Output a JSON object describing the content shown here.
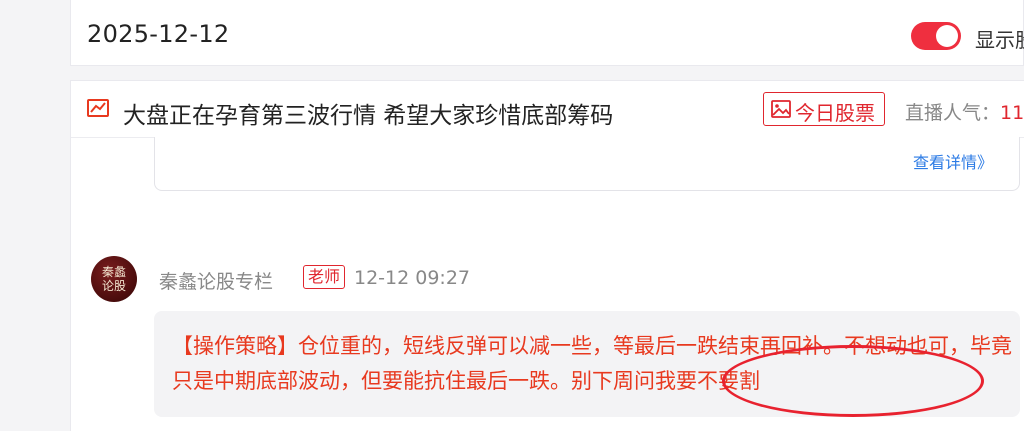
{
  "date_bar": {
    "date": "2025-12-12",
    "toggle_label": "显示股",
    "toggle_on": true
  },
  "live": {
    "title": "大盘正在孕育第三波行情 希望大家珍惜底部筹码",
    "stock_button": "今日股票",
    "popularity_label": "直播人气：",
    "popularity_value": "11",
    "detail_link": "查看详情》"
  },
  "post": {
    "avatar_text": [
      "秦蠡",
      "论股"
    ],
    "author": "秦蠡论股专栏",
    "role": "老师",
    "time": "12-12 09:27",
    "message": "【操作策略】仓位重的，短线反弹可以减一些，等最后一跌结束再回补。不想动也可，毕竟只是中期底部波动，但要能抗住最后一跌。别下周问我要不要割"
  },
  "colors": {
    "accent": "#e0262e",
    "link": "#2c7be5",
    "message": "#e8391f",
    "bubble": "#f3f3f5"
  },
  "icons": [
    "trend-chart-icon",
    "picture-icon"
  ]
}
